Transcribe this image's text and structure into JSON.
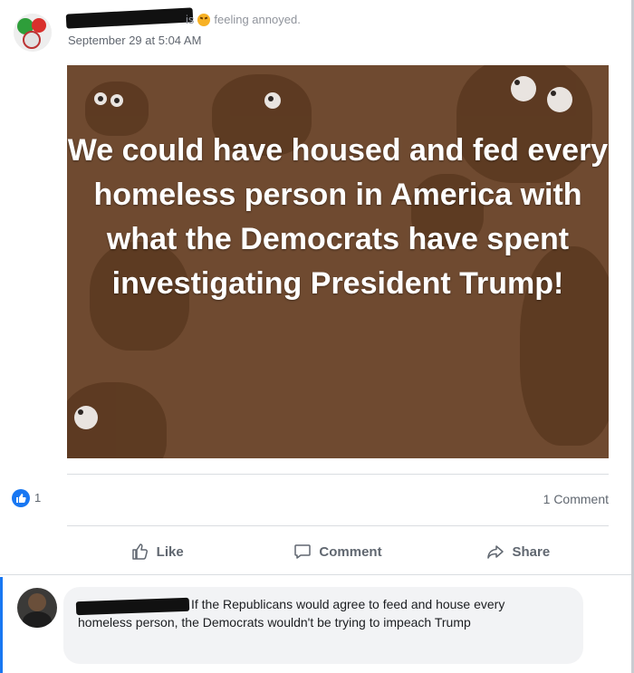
{
  "post": {
    "status_verb": "is",
    "feeling": "feeling annoyed.",
    "timestamp": "September 29 at 5:04 AM",
    "image_text": "We could have housed and fed every homeless person in America with what the Democrats have spent investigating President Trump!"
  },
  "reactions": {
    "like_count": "1",
    "comment_count": "1 Comment"
  },
  "actions": {
    "like": "Like",
    "comment": "Comment",
    "share": "Share"
  },
  "comment": {
    "text": "If the Republicans would agree to feed and house every homeless person, the Democrats wouldn't be trying to impeach Trump"
  },
  "colors": {
    "accent": "#1877f2",
    "image_bg": "#6f4a30",
    "muted_text": "#606770"
  }
}
